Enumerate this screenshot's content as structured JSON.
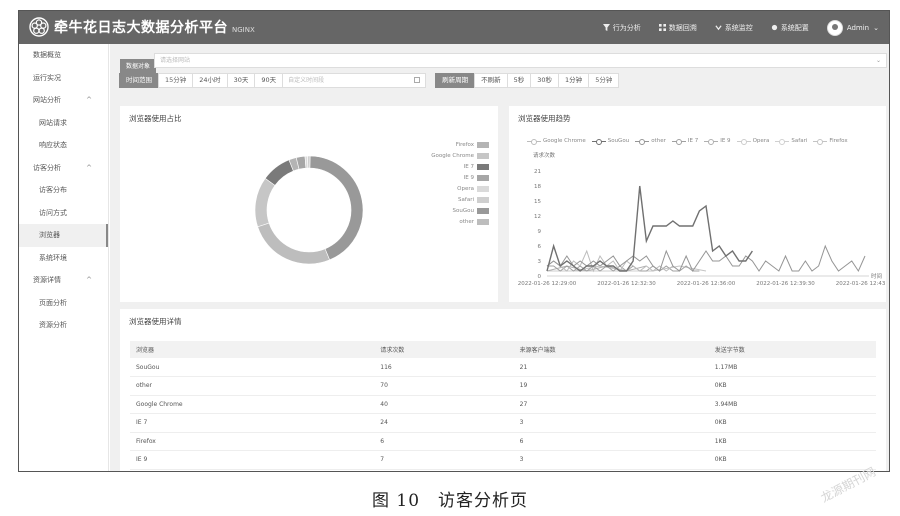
{
  "header": {
    "title": "牵牛花日志大数据分析平台",
    "subtitle": "NGINX",
    "nav": [
      {
        "label": "行为分析",
        "icon": "filter-icon"
      },
      {
        "label": "数据回溯",
        "icon": "grid-icon"
      },
      {
        "label": "系统监控",
        "icon": "chevron-icon"
      },
      {
        "label": "系统配置",
        "icon": "dot-icon"
      }
    ],
    "user": {
      "label": "Admin",
      "caret": "⌄"
    }
  },
  "sidebar": {
    "items": [
      {
        "label": "数据概览",
        "level": 0
      },
      {
        "label": "运行实况",
        "level": 0
      },
      {
        "label": "网站分析",
        "level": 0,
        "expanded": true
      },
      {
        "label": "网站请求",
        "level": 1
      },
      {
        "label": "响应状态",
        "level": 1
      },
      {
        "label": "访客分析",
        "level": 0,
        "expanded": true
      },
      {
        "label": "访客分布",
        "level": 1
      },
      {
        "label": "访问方式",
        "level": 1
      },
      {
        "label": "浏览器",
        "level": 1,
        "active": true
      },
      {
        "label": "系统环境",
        "level": 1
      },
      {
        "label": "资源详情",
        "level": 0,
        "expanded": true
      },
      {
        "label": "页面分析",
        "level": 1
      },
      {
        "label": "资源分析",
        "level": 1
      }
    ]
  },
  "filters": {
    "site_label": "数据对象",
    "site_placeholder": "请选择网站",
    "time_label": "时间范围",
    "time_options": [
      "15分钟",
      "24小时",
      "30天",
      "90天"
    ],
    "time_selected": "15分钟",
    "date_placeholder": "自定义时间段",
    "refresh_label": "刷新周期",
    "refresh_options": [
      "不刷新",
      "5秒",
      "30秒",
      "1分钟",
      "5分钟"
    ],
    "refresh_selected": "5分钟"
  },
  "pie_card": {
    "title": "浏览器使用占比",
    "legend": [
      {
        "name": "Firefox",
        "color": "#b4b4b4"
      },
      {
        "name": "Google Chrome",
        "color": "#c6c6c6"
      },
      {
        "name": "IE 7",
        "color": "#7a7a7a"
      },
      {
        "name": "IE 9",
        "color": "#a6a6a6"
      },
      {
        "name": "Opera",
        "color": "#dadada"
      },
      {
        "name": "Safari",
        "color": "#cfcfcf"
      },
      {
        "name": "SouGou",
        "color": "#999999"
      },
      {
        "name": "other",
        "color": "#bdbdbd"
      }
    ]
  },
  "line_card": {
    "title": "浏览器使用趋势"
  },
  "chart_data": [
    {
      "type": "pie",
      "title": "浏览器使用占比",
      "series": [
        {
          "name": "SouGou",
          "value": 116,
          "color": "#999999"
        },
        {
          "name": "other",
          "value": 70,
          "color": "#bdbdbd"
        },
        {
          "name": "Google Chrome",
          "value": 40,
          "color": "#c6c6c6"
        },
        {
          "name": "IE 7",
          "value": 24,
          "color": "#7a7a7a"
        },
        {
          "name": "Firefox",
          "value": 6,
          "color": "#b4b4b4"
        },
        {
          "name": "IE 9",
          "value": 7,
          "color": "#a6a6a6"
        },
        {
          "name": "Opera",
          "value": 2,
          "color": "#dadada"
        },
        {
          "name": "Safari",
          "value": 2,
          "color": "#cfcfcf"
        }
      ]
    },
    {
      "type": "line",
      "title": "浏览器使用趋势",
      "ylabel": "请求次数",
      "xlabel": "时间",
      "ylim": [
        0,
        21
      ],
      "yticks": [
        0,
        3,
        6,
        9,
        12,
        15,
        18,
        21
      ],
      "x_tick_labels": [
        "2022-01-26 12:29:00",
        "2022-01-26 12:32:30",
        "2022-01-26 12:36:00",
        "2022-01-26 12:39:30",
        "2022-01-26 12:43:00"
      ],
      "x_count": 49,
      "series": [
        {
          "name": "Google Chrome",
          "color": "#bcbcbc",
          "points": [
            [
              0,
              2
            ],
            [
              1,
              3
            ],
            [
              2,
              2
            ],
            [
              3,
              1
            ],
            [
              4,
              3
            ],
            [
              5,
              2
            ],
            [
              6,
              5
            ],
            [
              7,
              1
            ],
            [
              8,
              4
            ],
            [
              9,
              2
            ],
            [
              10,
              3
            ],
            [
              11,
              1
            ],
            [
              12,
              3
            ],
            [
              13,
              2
            ],
            [
              14,
              1
            ],
            [
              15,
              2
            ],
            [
              16,
              1
            ],
            [
              17,
              2
            ],
            [
              18,
              1
            ],
            [
              19,
              2
            ]
          ]
        },
        {
          "name": "SouGou",
          "color": "#707070",
          "points": [
            [
              0,
              1
            ],
            [
              1,
              6
            ],
            [
              2,
              2
            ],
            [
              3,
              3
            ],
            [
              4,
              2
            ],
            [
              5,
              1
            ],
            [
              6,
              2
            ],
            [
              7,
              2
            ],
            [
              8,
              3
            ],
            [
              9,
              2
            ],
            [
              10,
              2
            ],
            [
              11,
              1
            ],
            [
              12,
              1
            ],
            [
              13,
              3
            ],
            [
              14,
              18
            ],
            [
              15,
              7
            ],
            [
              16,
              10
            ],
            [
              17,
              10
            ],
            [
              18,
              10
            ],
            [
              19,
              11
            ],
            [
              20,
              10
            ],
            [
              21,
              10
            ],
            [
              22,
              10
            ],
            [
              23,
              13
            ],
            [
              24,
              14
            ],
            [
              25,
              5
            ],
            [
              26,
              6
            ],
            [
              27,
              4
            ],
            [
              28,
              5
            ],
            [
              29,
              3
            ],
            [
              30,
              3
            ],
            [
              31,
              5
            ]
          ]
        },
        {
          "name": "other",
          "color": "#959595",
          "points": [
            [
              0,
              2
            ],
            [
              1,
              3
            ],
            [
              2,
              2
            ],
            [
              3,
              4
            ],
            [
              4,
              2
            ],
            [
              5,
              3
            ],
            [
              6,
              2
            ],
            [
              7,
              3
            ],
            [
              8,
              2
            ],
            [
              9,
              3
            ],
            [
              10,
              4
            ],
            [
              11,
              2
            ],
            [
              12,
              3
            ],
            [
              13,
              4
            ],
            [
              14,
              3
            ],
            [
              15,
              4
            ],
            [
              16,
              2
            ],
            [
              17,
              1
            ],
            [
              18,
              5
            ],
            [
              19,
              2
            ],
            [
              20,
              1
            ],
            [
              21,
              4
            ],
            [
              22,
              1
            ],
            [
              23,
              3
            ],
            [
              24,
              5
            ],
            [
              25,
              3
            ],
            [
              26,
              3
            ],
            [
              27,
              4
            ],
            [
              28,
              2
            ],
            [
              29,
              2
            ],
            [
              30,
              4
            ],
            [
              31,
              3
            ],
            [
              32,
              1
            ],
            [
              33,
              3
            ],
            [
              34,
              2
            ],
            [
              35,
              1
            ],
            [
              36,
              4
            ],
            [
              37,
              1
            ],
            [
              38,
              1
            ],
            [
              39,
              3
            ],
            [
              40,
              1
            ],
            [
              41,
              2
            ],
            [
              42,
              6
            ],
            [
              43,
              3
            ],
            [
              44,
              1
            ],
            [
              45,
              2
            ],
            [
              46,
              3
            ],
            [
              47,
              1
            ],
            [
              48,
              4
            ]
          ]
        },
        {
          "name": "IE 7",
          "color": "#a0a0a0",
          "points": [
            [
              0,
              2
            ],
            [
              1,
              2
            ],
            [
              2,
              1
            ],
            [
              3,
              2
            ],
            [
              4,
              1
            ],
            [
              5,
              2
            ],
            [
              6,
              1
            ],
            [
              7,
              2
            ],
            [
              8,
              1
            ],
            [
              9,
              2
            ],
            [
              10,
              1
            ],
            [
              11,
              2
            ],
            [
              12,
              1
            ],
            [
              13,
              2
            ],
            [
              14,
              1
            ],
            [
              15,
              1
            ],
            [
              16,
              2
            ],
            [
              17,
              1
            ],
            [
              18,
              2
            ],
            [
              19,
              1
            ],
            [
              20,
              1
            ],
            [
              21,
              2
            ],
            [
              22,
              1
            ],
            [
              23,
              1
            ]
          ]
        },
        {
          "name": "IE 9",
          "color": "#b0b0b0",
          "points": [
            [
              0,
              1
            ],
            [
              3,
              2
            ],
            [
              6,
              1
            ],
            [
              9,
              2
            ],
            [
              12,
              1
            ],
            [
              15,
              2
            ]
          ]
        },
        {
          "name": "Opera",
          "color": "#cccccc",
          "points": [
            [
              0,
              1
            ],
            [
              6,
              1
            ],
            [
              12,
              1
            ]
          ]
        },
        {
          "name": "Safari",
          "color": "#d0d0d0",
          "points": [
            [
              2,
              1
            ],
            [
              8,
              1
            ],
            [
              14,
              1
            ]
          ]
        },
        {
          "name": "Firefox",
          "color": "#c4c4c4",
          "points": [
            [
              0,
              1
            ],
            [
              4,
              1
            ],
            [
              8,
              2
            ],
            [
              12,
              1
            ],
            [
              16,
              1
            ],
            [
              20,
              2
            ],
            [
              24,
              1
            ]
          ]
        }
      ]
    }
  ],
  "table": {
    "title": "浏览器使用详情",
    "headers": [
      "浏览器",
      "请求次数",
      "来源客户端数",
      "发送字节数"
    ],
    "rows": [
      [
        "SouGou",
        "116",
        "21",
        "1.17MB"
      ],
      [
        "other",
        "70",
        "19",
        "0KB"
      ],
      [
        "Google Chrome",
        "40",
        "27",
        "3.94MB"
      ],
      [
        "IE 7",
        "24",
        "3",
        "0KB"
      ],
      [
        "Firefox",
        "6",
        "6",
        "1KB"
      ],
      [
        "IE 9",
        "7",
        "3",
        "0KB"
      ]
    ]
  },
  "caption": "图 10　访客分析页",
  "watermark": "龙源期刊网"
}
